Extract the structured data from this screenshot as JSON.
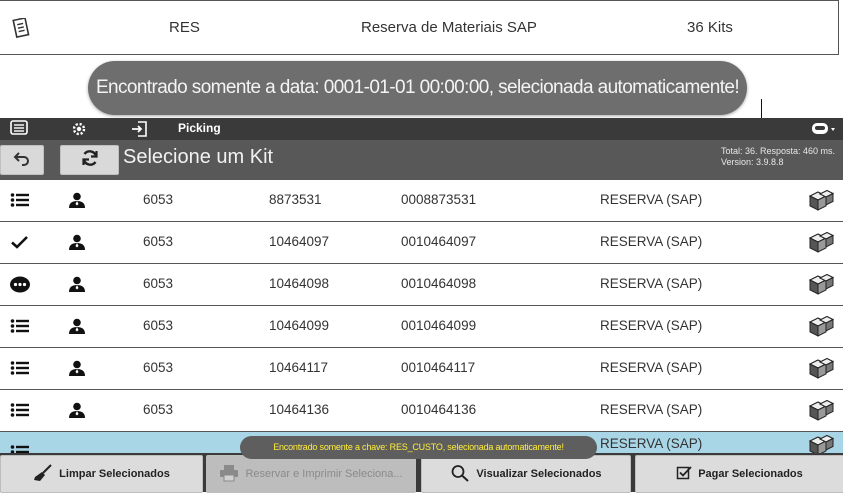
{
  "summary": {
    "icon": "document-icon",
    "code": "RES",
    "description": "Reserva de Materiais SAP",
    "count": "36 Kits"
  },
  "toast_main": "Encontrado somente a data: 0001-01-01 00:00:00, selecionada automaticamente!",
  "actionbar": {
    "icons": [
      "menu-icon",
      "gear-icon",
      "login-icon",
      "profile-menu-icon"
    ],
    "picking_label": "Picking"
  },
  "titlebar": {
    "back_icon": "back-arrow-icon",
    "refresh_icon": "refresh-icon",
    "title": "Selecione um Kit",
    "meta_line1": "Total: 36. Resposta: 460 ms.",
    "meta_line2": "Version: 3.9.8.8"
  },
  "rows": [
    {
      "status": "list-icon",
      "c1": "6053",
      "c2": "8873531",
      "c3": "0008873531",
      "c4": "RESERVA (SAP)"
    },
    {
      "status": "check-icon",
      "c1": "6053",
      "c2": "10464097",
      "c3": "0010464097",
      "c4": "RESERVA (SAP)"
    },
    {
      "status": "more-icon",
      "c1": "6053",
      "c2": "10464098",
      "c3": "0010464098",
      "c4": "RESERVA (SAP)"
    },
    {
      "status": "list-icon",
      "c1": "6053",
      "c2": "10464099",
      "c3": "0010464099",
      "c4": "RESERVA (SAP)"
    },
    {
      "status": "list-icon",
      "c1": "6053",
      "c2": "10464117",
      "c3": "0010464117",
      "c4": "RESERVA (SAP)"
    },
    {
      "status": "list-icon",
      "c1": "6053",
      "c2": "10464136",
      "c3": "0010464136",
      "c4": "RESERVA (SAP)"
    },
    {
      "status": "list-icon",
      "c1": "",
      "c2": "",
      "c3": "",
      "c4": "RESERVA (SAP)"
    }
  ],
  "toast_small": "Encontrado somente a chave: RES_CUSTO, selecionada automaticamente!",
  "bottombar": {
    "clear_label": "Limpar Selecionados",
    "reserve_print_label": "Reservar e Imprimir Seleciona...",
    "view_label": "Visualizar Selecionados",
    "pay_label": "Pagar Selecionados"
  },
  "colors": {
    "highlight_row": "#a9d6e6",
    "toast_small_text": "#ffee3a",
    "bar_dark": "#3a3a3a"
  }
}
